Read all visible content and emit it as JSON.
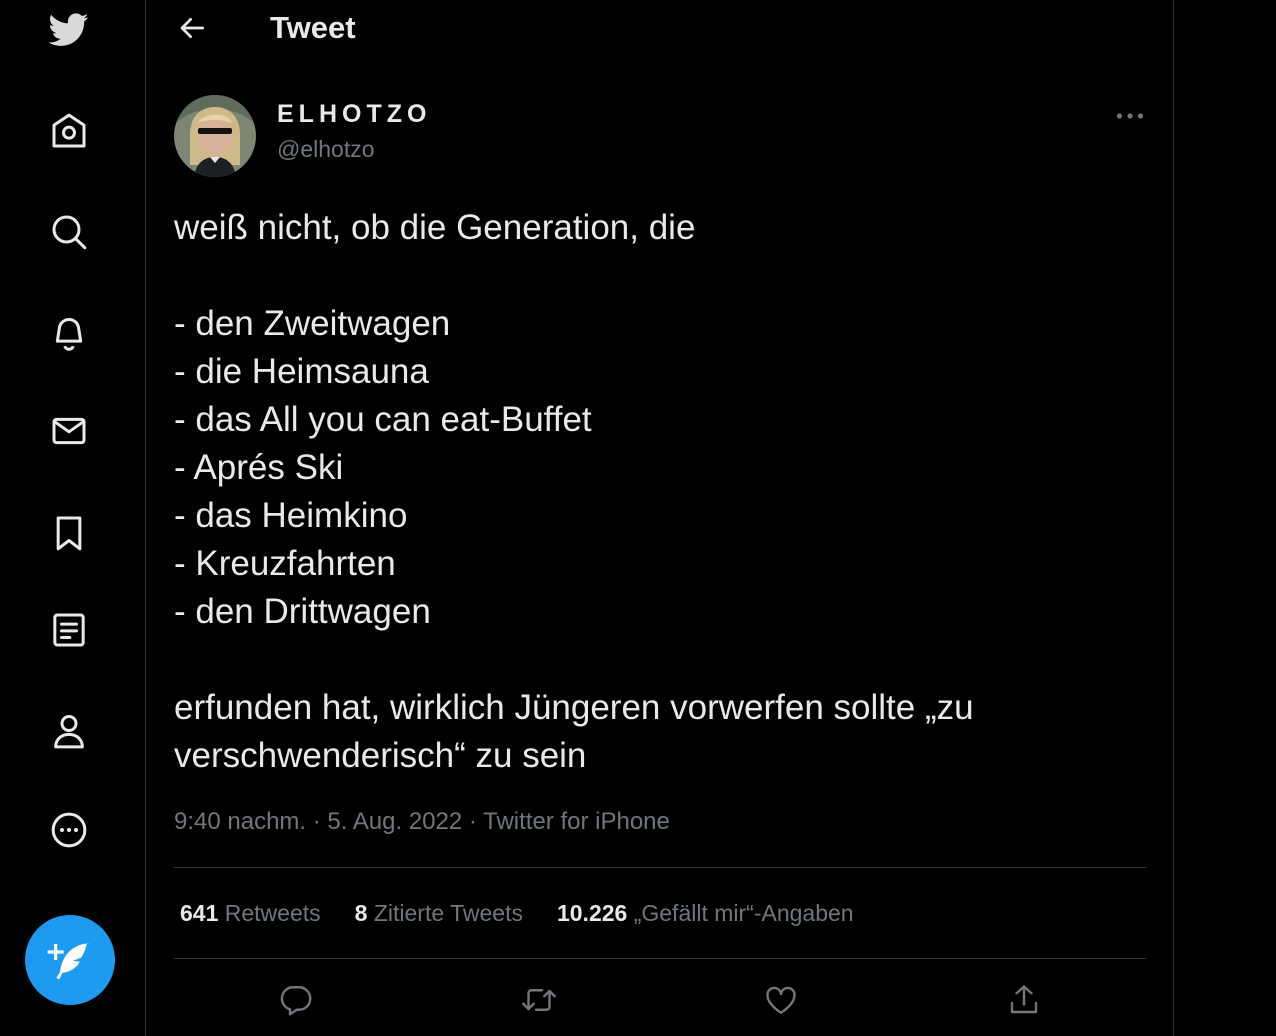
{
  "nav": {
    "items": [
      {
        "icon": "twitter-logo-icon"
      },
      {
        "icon": "home-icon"
      },
      {
        "icon": "search-icon"
      },
      {
        "icon": "notifications-icon"
      },
      {
        "icon": "messages-icon"
      },
      {
        "icon": "bookmarks-icon"
      },
      {
        "icon": "lists-icon"
      },
      {
        "icon": "profile-icon"
      },
      {
        "icon": "more-icon"
      }
    ],
    "compose_icon": "compose-tweet-icon",
    "accent": "#1d9bf0"
  },
  "header": {
    "title": "Tweet"
  },
  "tweet": {
    "author_name": "ELHOTZO",
    "author_handle": "@elhotzo",
    "lines": [
      "weiß nicht, ob die Generation, die",
      "",
      "- den Zweitwagen",
      "- die Heimsauna",
      "- das All you can eat-Buffet",
      "- Aprés Ski",
      "- das Heimkino",
      "- Kreuzfahrten",
      "- den Drittwagen",
      "",
      "erfunden hat, wirklich Jüngeren vorwerfen sollte „zu",
      "verschwenderisch“ zu sein"
    ],
    "time": "9:40 nachm.",
    "separator": " · ",
    "date": "5. Aug. 2022",
    "source": "Twitter for iPhone"
  },
  "stats": {
    "retweets_count": "641",
    "retweets_label": " Retweets",
    "quotes_count": "8",
    "quotes_label": " Zitierte Tweets",
    "likes_count": "10.226",
    "likes_label": " „Gefällt mir“-Angaben"
  },
  "colors": {
    "background": "#000000",
    "text": "#e7e9ea",
    "secondary": "#71767b",
    "border": "#2f3336"
  }
}
